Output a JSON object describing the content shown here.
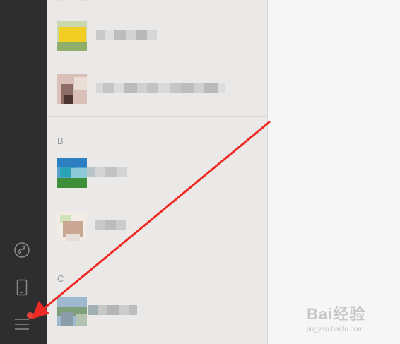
{
  "sidebar": {
    "icons": [
      "mini-program-icon",
      "phone-icon",
      "menu-icon"
    ],
    "menu_badge_color": "#e8413c"
  },
  "contacts": {
    "sections": [
      {
        "letter": ""
      },
      {
        "letter": "B"
      },
      {
        "letter": "C"
      }
    ]
  },
  "annotation": {
    "arrow_color": "#ee2a24"
  },
  "watermark": {
    "text": "Bai经验",
    "url": "jingyan.baidu.com"
  }
}
